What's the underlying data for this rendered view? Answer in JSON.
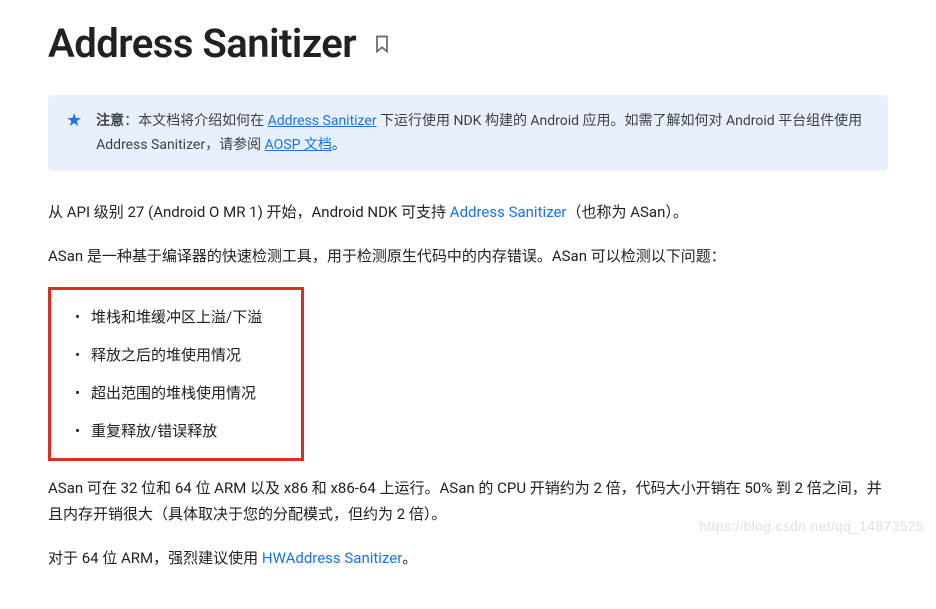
{
  "title": "Address Sanitizer",
  "note": {
    "label": "注意",
    "colon": "：",
    "part1": "本文档将介绍如何在 ",
    "link1": "Address Sanitizer",
    "part2": " 下运行使用 NDK 构建的 Android 应用。如需了解如何对 Android 平台组件使用 Address Sanitizer，请参阅 ",
    "link2": "AOSP 文档",
    "part3": "。"
  },
  "para1": {
    "part1": "从 API 级别 27 (Android O MR 1) 开始，Android NDK 可支持 ",
    "link1": "Address Sanitizer",
    "part2": "（也称为 ASan）。"
  },
  "para2": "ASan 是一种基于编译器的快速检测工具，用于检测原生代码中的内存错误。ASan 可以检测以下问题：",
  "issues": [
    "堆栈和堆缓冲区上溢/下溢",
    "释放之后的堆使用情况",
    "超出范围的堆栈使用情况",
    "重复释放/错误释放"
  ],
  "para3": "ASan 可在 32 位和 64 位 ARM 以及 x86 和 x86-64 上运行。ASan 的 CPU 开销约为 2 倍，代码大小开销在 50% 到 2 倍之间，并且内存开销很大（具体取决于您的分配模式，但约为 2 倍）。",
  "para4": {
    "part1": "对于 64 位 ARM，强烈建议使用 ",
    "link1": "HWAddress Sanitizer",
    "part2": "。"
  },
  "watermark": "https://blog.csdn.net/qq_14873525"
}
